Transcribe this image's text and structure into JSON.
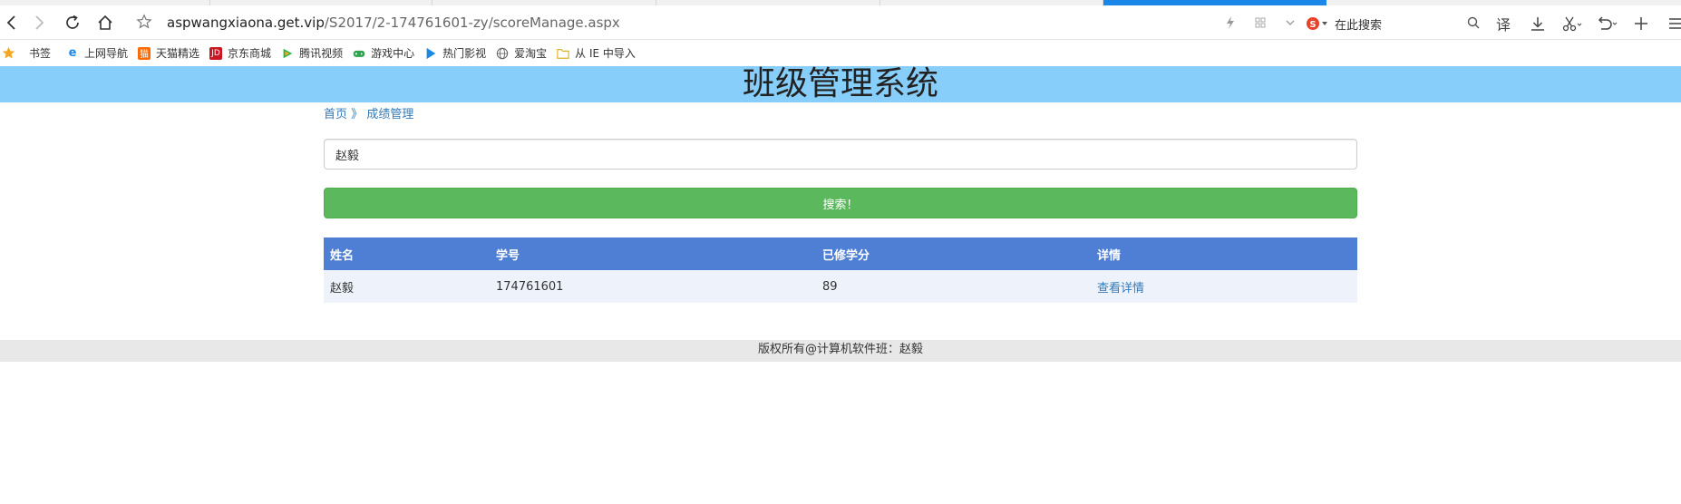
{
  "browser": {
    "url_domain": "aspwangxiaona.get.vip",
    "url_path": "/S2017/2-174761601-zy/scoreManage.aspx",
    "search_placeholder": "在此搜索",
    "translate_label": "译",
    "accent_color": "#1a86e8"
  },
  "bookmarks": [
    {
      "label": "书签",
      "icon": "star-icon",
      "color": "#f5a623"
    },
    {
      "label": "上网导航",
      "icon": "ie-icon",
      "color": "#1e88e5"
    },
    {
      "label": "天猫精选",
      "icon": "tmall-icon",
      "color": "#ff6a00"
    },
    {
      "label": "京东商城",
      "icon": "jd-icon",
      "color": "#c81623"
    },
    {
      "label": "腾讯视频",
      "icon": "tencent-video-icon",
      "color": "#20b74a"
    },
    {
      "label": "游戏中心",
      "icon": "gamepad-icon",
      "color": "#2ea44f"
    },
    {
      "label": "热门影视",
      "icon": "play-icon",
      "color": "#1e88e5"
    },
    {
      "label": "爱淘宝",
      "icon": "globe-icon",
      "color": "#666666"
    },
    {
      "label": "从 IE 中导入",
      "icon": "folder-icon",
      "color": "#f2c744"
    }
  ],
  "page": {
    "title": "班级管理系统",
    "header_color": "#87cefa",
    "breadcrumb": {
      "home": "首页",
      "sep": "》",
      "current": "成绩管理"
    },
    "search_value": "赵毅",
    "search_button": "搜索！",
    "table": {
      "headers": [
        "姓名",
        "学号",
        "已修学分",
        "详情"
      ],
      "rows": [
        {
          "name": "赵毅",
          "student_id": "174761601",
          "credits": "89",
          "detail": "查看详情"
        }
      ]
    },
    "footer": "版权所有@计算机软件班：赵毅"
  }
}
